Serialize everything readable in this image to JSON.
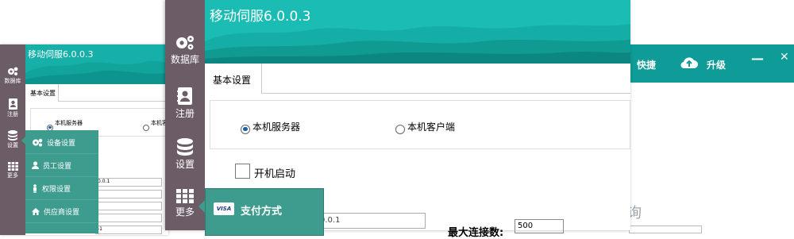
{
  "background_window": {
    "header": {
      "shortcut_label": "快捷",
      "upgrade_label": "升级",
      "minimize_glyph": "—",
      "close_glyph": "✕"
    },
    "partial_text": "询"
  },
  "small_window": {
    "title": "移动伺服6.0.0.3",
    "sidebar": [
      {
        "label": "数据库",
        "icon": "gears-icon"
      },
      {
        "label": "注册",
        "icon": "contact-book-icon"
      },
      {
        "label": "设置",
        "icon": "database-icon"
      },
      {
        "label": "更多",
        "icon": "grid-icon"
      }
    ],
    "tab_label": "基本设置",
    "radio_server": "本机服务器",
    "radio_client": "本机客",
    "field_values": [
      "0.0.1",
      "",
      "",
      "",
      "-1"
    ],
    "menu_items": [
      {
        "label": "设备设置",
        "icon": "gears-icon"
      },
      {
        "label": "员工设置",
        "icon": "user-icon"
      },
      {
        "label": "权限设置",
        "icon": "person-icon"
      },
      {
        "label": "供应商设置",
        "icon": "home-icon"
      }
    ]
  },
  "main_window": {
    "title": "移动伺服6.0.0.3",
    "sidebar": [
      {
        "label": "数据库",
        "icon": "gears-icon"
      },
      {
        "label": "注册",
        "icon": "contact-book-icon"
      },
      {
        "label": "设置",
        "icon": "database-icon"
      },
      {
        "label": "更多",
        "icon": "grid-icon"
      }
    ],
    "tab_label": "基本设置",
    "radio_server": "本机服务器",
    "radio_server_selected": true,
    "radio_client": "本机客户端",
    "radio_client_selected": false,
    "autostart_label": "开机启动",
    "autostart_checked": false,
    "ip_value": "0.0.1",
    "max_conn_label": "最大连接数:",
    "max_conn_value": "500",
    "popup": {
      "badge": "VISA",
      "label": "支付方式"
    }
  },
  "colors": {
    "sidebar": "#6b5c66",
    "header_teal": "#1abcb3",
    "menu_teal": "#3e9c8f",
    "radio_blue": "#1a5fb4"
  }
}
